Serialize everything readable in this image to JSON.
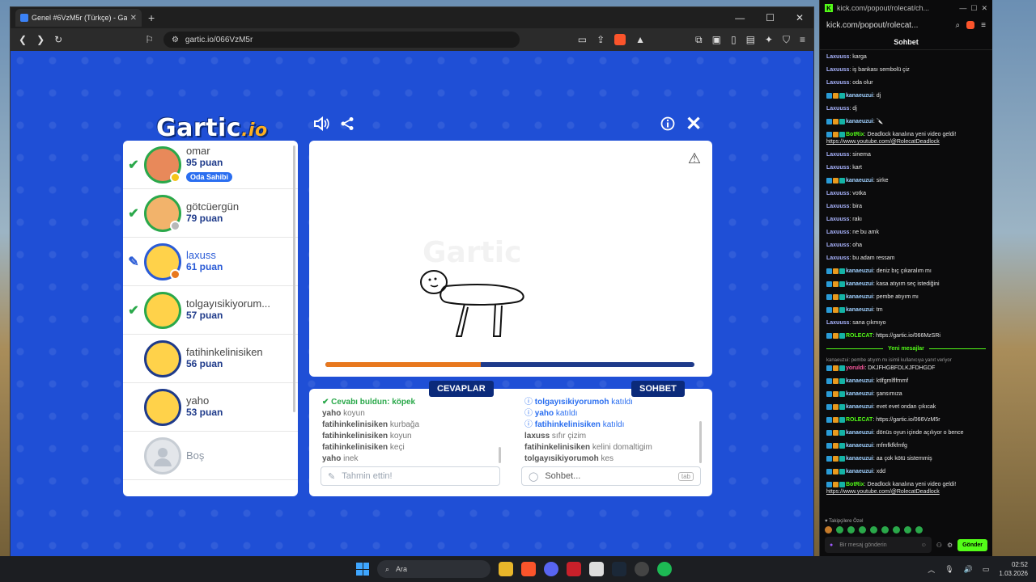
{
  "browser": {
    "tab_title": "Genel #6VzM5r (Türkçe) - Gar",
    "url": "gartic.io/066VzM5r"
  },
  "game": {
    "logo_main": "Gartic",
    "logo_io": ".io",
    "players": [
      {
        "name": "omar",
        "score": "95 puan",
        "status": "guessed",
        "badge": "Oda Sahibi",
        "dot_color": "#f5c518"
      },
      {
        "name": "götcüergün",
        "score": "79 puan",
        "status": "guessed",
        "dot_color": "#b8b8b8"
      },
      {
        "name": "laxuss",
        "score": "61 puan",
        "status": "drawing",
        "dot_color": "#e8781e"
      },
      {
        "name": "tolgayısikiyorum...",
        "score": "57 puan",
        "status": "guessed"
      },
      {
        "name": "fatihinkelinisiken",
        "score": "56 puan",
        "status": "none"
      },
      {
        "name": "yaho",
        "score": "53 puan",
        "status": "none"
      },
      {
        "name": "Boş",
        "score": "",
        "status": "empty"
      }
    ],
    "progress": 0.42,
    "tabs": {
      "answers": "CEVAPLAR",
      "chat": "SOHBET"
    },
    "answers": [
      {
        "user": "Cevabı buldun:",
        "text": "köpek",
        "type": "correct"
      },
      {
        "user": "yaho",
        "text": "koyun"
      },
      {
        "user": "fatihinkelinisiken",
        "text": "kurbağa"
      },
      {
        "user": "fatihinkelinisiken",
        "text": "koyun"
      },
      {
        "user": "fatihinkelinisiken",
        "text": "keçi"
      },
      {
        "user": "yaho",
        "text": "inek"
      }
    ],
    "chat": [
      {
        "user": "tolgayısikiyorumoh",
        "text": "katıldı",
        "type": "join"
      },
      {
        "user": "yaho",
        "text": "katıldı",
        "type": "join"
      },
      {
        "user": "fatihinkelinisiken",
        "text": "katıldı",
        "type": "join"
      },
      {
        "user": "laxuss",
        "text": "sıfır çizim"
      },
      {
        "user": "fatihinkelinisiken",
        "text": "kelini domaltigim"
      },
      {
        "user": "tolgayısikiyorumoh",
        "text": "kes"
      }
    ],
    "guess_placeholder": "Tahmin ettin!",
    "chat_placeholder": "Sohbet...",
    "tab_key": "tab"
  },
  "kick": {
    "window_title": "kick.com/popout/rolecat/ch...",
    "url": "kick.com/popout/rolecat...",
    "header": "Sohbet",
    "messages": [
      {
        "user": "Laxuuss",
        "cls": "lax",
        "text": "karga"
      },
      {
        "user": "Laxuuss",
        "cls": "lax",
        "text": "iş bankası sembolü çiz"
      },
      {
        "user": "Laxuuss",
        "cls": "lax",
        "text": "oda olur"
      },
      {
        "user": "kanaeuzui",
        "cls": "kan",
        "text": "dj",
        "badges": true
      },
      {
        "user": "Laxuuss",
        "cls": "lax",
        "text": "dj"
      },
      {
        "user": "kanaeuzui",
        "cls": "kan",
        "text": "🔪",
        "badges": true
      },
      {
        "user": "BotRix",
        "cls": "bot",
        "text": "Deadlock kanalına yeni video geldi!",
        "link": "https://www.youtube.com/@RolecatDeadlock",
        "badges": true
      },
      {
        "user": "Laxuuss",
        "cls": "lax",
        "text": "sinema"
      },
      {
        "user": "Laxuuss",
        "cls": "lax",
        "text": "kart"
      },
      {
        "user": "kanaeuzui",
        "cls": "kan",
        "text": "sirke",
        "badges": true
      },
      {
        "user": "Laxuuss",
        "cls": "lax",
        "text": "votka"
      },
      {
        "user": "Laxuuss",
        "cls": "lax",
        "text": "bira"
      },
      {
        "user": "Laxuuss",
        "cls": "lax",
        "text": "rakı"
      },
      {
        "user": "Laxuuss",
        "cls": "lax",
        "text": "ne bu amk"
      },
      {
        "user": "Laxuuss",
        "cls": "lax",
        "text": "oha"
      },
      {
        "user": "Laxuuss",
        "cls": "lax",
        "text": "bu adam ressam"
      },
      {
        "user": "kanaeuzui",
        "cls": "kan",
        "text": "deniz bıç çıkaralım mı",
        "badges": true
      },
      {
        "user": "kanaeuzui",
        "cls": "kan",
        "text": "kasa atıyım seç istediğini",
        "badges": true
      },
      {
        "user": "kanaeuzui",
        "cls": "kan",
        "text": "pembe atıyım mı",
        "badges": true
      },
      {
        "user": "kanaeuzui",
        "cls": "kan",
        "text": "tm",
        "badges": true
      },
      {
        "user": "Laxuuss",
        "cls": "lax",
        "text": "sana çıkmıyo"
      },
      {
        "user": "ROLECAT",
        "cls": "role",
        "text": "https://gartic.io/066MzSRi",
        "badges": true
      }
    ],
    "new_messages": "Yeni mesajlar",
    "reply_note": "kanaeuzui: pembe atıyım mı isimli kullanıcıya yanıt veriyor",
    "messages_new": [
      {
        "user": "yoruldi",
        "cls": "pink",
        "text": "DKJFHGBFDLKJFDHGDF",
        "badges": true
      },
      {
        "user": "kanaeuzui",
        "cls": "kan",
        "text": "ktlfgmlflfmmf",
        "badges": true
      },
      {
        "user": "kanaeuzui",
        "cls": "kan",
        "text": "şansımıza",
        "badges": true
      },
      {
        "user": "kanaeuzui",
        "cls": "kan",
        "text": "evet evet ondan çıkıcak",
        "badges": true
      },
      {
        "user": "ROLECAT",
        "cls": "role",
        "text": "https://gartic.io/066VzM5r",
        "badges": true
      },
      {
        "user": "kanaeuzui",
        "cls": "kan",
        "text": "dönüs oyun içinde açılıyor o bence",
        "badges": true
      },
      {
        "user": "kanaeuzui",
        "cls": "kan",
        "text": "mfmfkfkfmfg",
        "badges": true
      },
      {
        "user": "kanaeuzui",
        "cls": "kan",
        "text": "aa çok kötü sistemmiş",
        "badges": true
      },
      {
        "user": "kanaeuzui",
        "cls": "kan",
        "text": "xdd",
        "badges": true
      },
      {
        "user": "BotRix",
        "cls": "bot",
        "text": "Deadlock kanalına yeni video geldi!",
        "link": "https://www.youtube.com/@RolecatDeadlock",
        "badges": true
      }
    ],
    "followers_label": "Takipçilere Özel",
    "send_placeholder": "Bir mesaj gönderin",
    "send_button": "Gönder"
  },
  "taskbar": {
    "search": "Ara",
    "time": "02:52",
    "date": "1.03.2026"
  }
}
